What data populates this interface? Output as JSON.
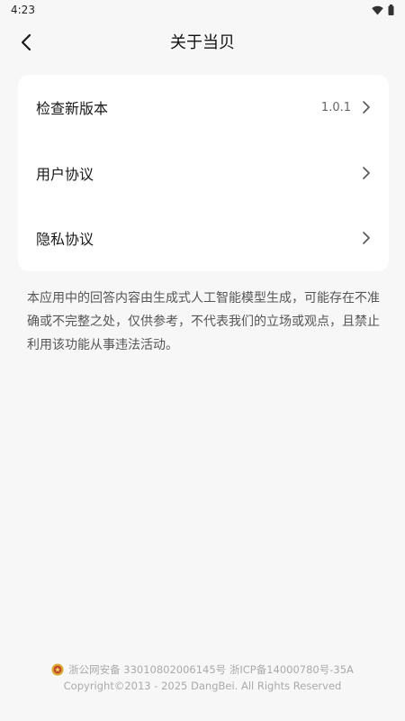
{
  "status_bar": {
    "time": "4:23",
    "icons": [
      "wifi-icon",
      "battery-icon"
    ]
  },
  "header": {
    "title": "关于当贝",
    "back_icon": "chevron-left-icon"
  },
  "menu": {
    "items": [
      {
        "label": "检查新版本",
        "value": "1.0.1",
        "icon": "chevron-right-icon"
      },
      {
        "label": "用户协议",
        "value": "",
        "icon": "chevron-right-icon"
      },
      {
        "label": "隐私协议",
        "value": "",
        "icon": "chevron-right-icon"
      }
    ]
  },
  "disclaimer": "本应用中的回答内容由生成式人工智能模型生成，可能存在不准确或不完整之处，仅供参考，不代表我们的立场或观点，且禁止利用该功能从事违法活动。",
  "footer": {
    "badge_icon": "police-badge-icon",
    "registration": "浙公网安备 33010802006145号 浙ICP备14000780号-35A",
    "copyright": "Copyright©2013 - 2025 DangBei. All Rights Reserved"
  },
  "colors": {
    "background": "#f7f7f7",
    "card": "#ffffff",
    "text_primary": "#1a1a1a",
    "text_secondary": "#555555",
    "footer_text": "#aaaaaa"
  }
}
